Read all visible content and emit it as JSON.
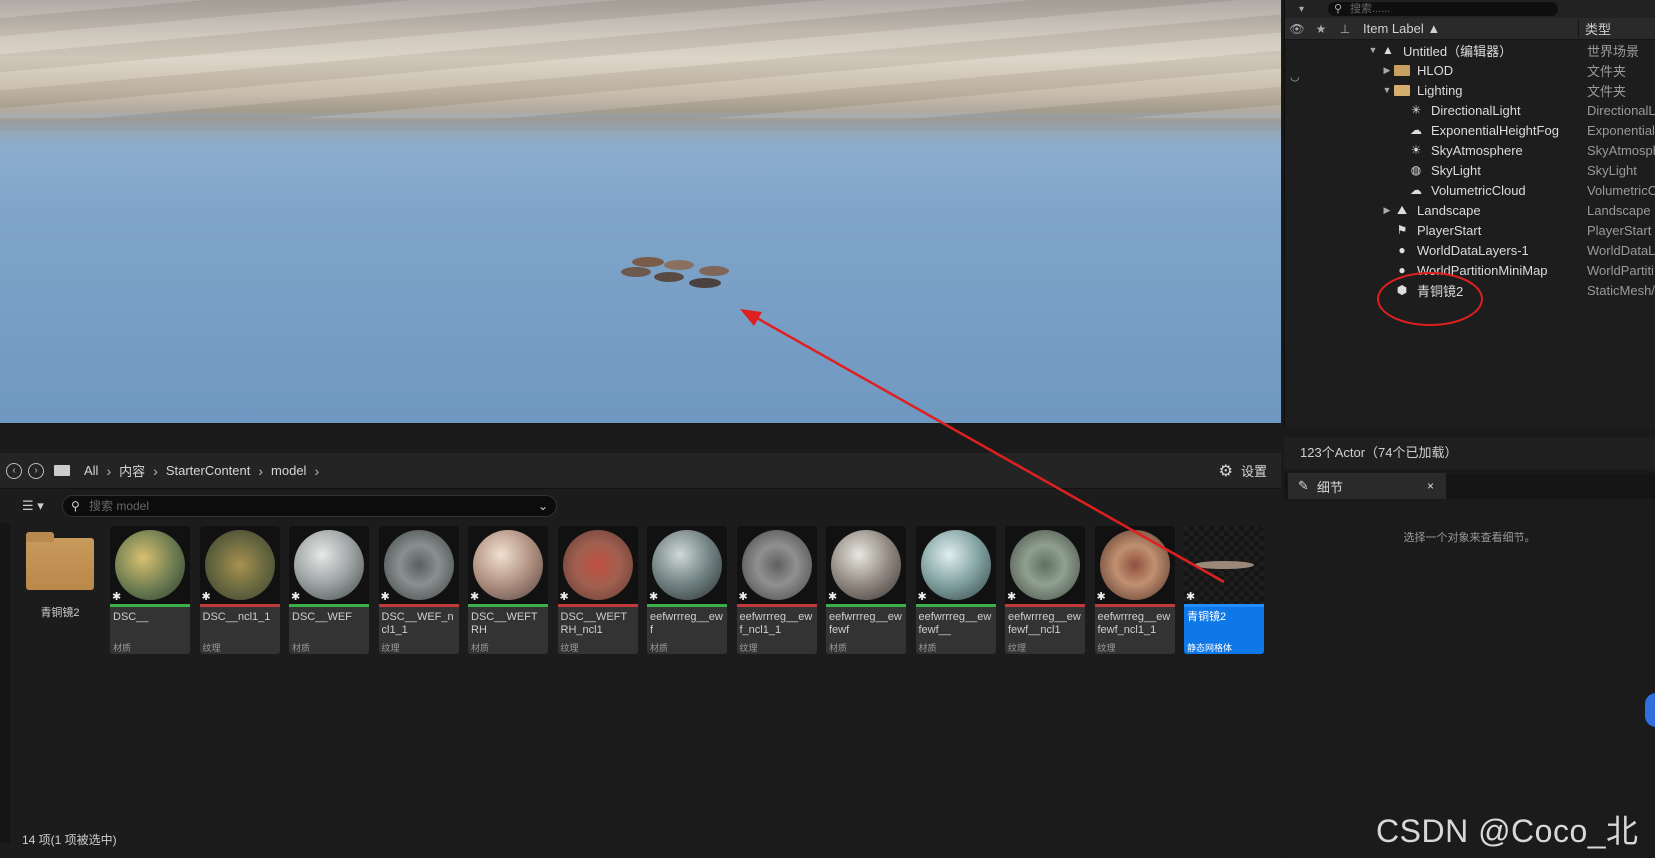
{
  "outliner": {
    "search_placeholder": "搜索......",
    "header": {
      "label": "Item Label ▲",
      "type": "类型"
    },
    "rows": [
      {
        "name": "Untitled（编辑器）",
        "type": "世界场景",
        "indent": 0,
        "arrow": "▼",
        "icon": "world-icon"
      },
      {
        "name": "HLOD",
        "type": "文件夹",
        "indent": 1,
        "arrow": "▶",
        "icon": "folder-icon"
      },
      {
        "name": "Lighting",
        "type": "文件夹",
        "indent": 1,
        "arrow": "▼",
        "icon": "folder-open-icon"
      },
      {
        "name": "DirectionalLight",
        "type": "DirectionalL",
        "indent": 2,
        "arrow": "",
        "icon": "directional-light-icon"
      },
      {
        "name": "ExponentialHeightFog",
        "type": "Exponentiall",
        "indent": 2,
        "arrow": "",
        "icon": "fog-icon"
      },
      {
        "name": "SkyAtmosphere",
        "type": "SkyAtmosph",
        "indent": 2,
        "arrow": "",
        "icon": "sky-atmosphere-icon"
      },
      {
        "name": "SkyLight",
        "type": "SkyLight",
        "indent": 2,
        "arrow": "",
        "icon": "sky-light-icon"
      },
      {
        "name": "VolumetricCloud",
        "type": "VolumetricC",
        "indent": 2,
        "arrow": "",
        "icon": "cloud-icon"
      },
      {
        "name": "Landscape",
        "type": "Landscape",
        "indent": 1,
        "arrow": "▶",
        "icon": "landscape-icon"
      },
      {
        "name": "PlayerStart",
        "type": "PlayerStart",
        "indent": 1,
        "arrow": "",
        "icon": "player-start-icon"
      },
      {
        "name": "WorldDataLayers-1",
        "type": "WorldDataL",
        "indent": 1,
        "arrow": "",
        "icon": "data-layers-icon"
      },
      {
        "name": "WorldPartitionMiniMap",
        "type": "WorldPartiti",
        "indent": 1,
        "arrow": "",
        "icon": "minimap-icon"
      },
      {
        "name": "青铜镜2",
        "type": "StaticMesh/",
        "indent": 1,
        "arrow": "",
        "icon": "static-mesh-icon"
      }
    ]
  },
  "actor_count": "123个Actor（74个已加载）",
  "details": {
    "tab_label": "细节",
    "close": "×",
    "hint": "选择一个对象来查看细节。"
  },
  "content_browser": {
    "breadcrumbs": [
      "All",
      "内容",
      "StarterContent",
      "model"
    ],
    "settings_label": "设置",
    "search_placeholder": "搜索 model",
    "folder": {
      "name": "青铜镜2"
    },
    "assets": [
      {
        "name": "DSC__",
        "type": "材质",
        "bar": "#3bb04a",
        "disc": "radial-gradient(circle at 40% 40%, #d8c070, #6a7a50 55%, #2a3a30)"
      },
      {
        "name": "DSC__ncl1_1",
        "type": "纹理",
        "bar": "#c23a3a",
        "disc": "radial-gradient(circle at 50% 50%, #a89050, #6a6a40 50%, #3a4030)"
      },
      {
        "name": "DSC__WEF",
        "type": "材质",
        "bar": "#3bb04a",
        "disc": "radial-gradient(circle at 40% 35%, #e8e8e8, #9aa0a0 50%, #404848)"
      },
      {
        "name": "DSC__WEF_ncl1_1",
        "type": "纹理",
        "bar": "#c23a3a",
        "disc": "radial-gradient(circle at 50% 50%, #5a6060, #8a9090 40%, #3a4040)"
      },
      {
        "name": "DSC__WEFTRH",
        "type": "材质",
        "bar": "#3bb04a",
        "disc": "radial-gradient(circle at 40% 35%, #f0e0d0, #b09080 50%, #504040)"
      },
      {
        "name": "DSC__WEFTRH_ncl1",
        "type": "纹理",
        "bar": "#c23a3a",
        "disc": "radial-gradient(circle at 50% 50%, #c05040, #a06050 45%, #603830)"
      },
      {
        "name": "eefwrrreg__ewf",
        "type": "材质",
        "bar": "#3bb04a",
        "disc": "radial-gradient(circle at 40% 35%, #d0d8d8, #708080 50%, #283030)"
      },
      {
        "name": "eefwrrreg__ewf_ncl1_1",
        "type": "纹理",
        "bar": "#c23a3a",
        "disc": "radial-gradient(circle at 50% 50%, #606060, #909090 40%, #404040)"
      },
      {
        "name": "eefwrrreg__ewfewf",
        "type": "材质",
        "bar": "#3bb04a",
        "disc": "radial-gradient(circle at 40% 35%, #e8e8e0, #908880 50%, #383030)"
      },
      {
        "name": "eefwrrreg__ewfewf__",
        "type": "材质",
        "bar": "#3bb04a",
        "disc": "radial-gradient(circle at 40% 35%, #e0eeee, #80a0a0 50%, #304040)"
      },
      {
        "name": "eefwrrreg__ewfewf__ncl1",
        "type": "纹理",
        "bar": "#c23a3a",
        "disc": "radial-gradient(circle at 50% 50%, #607060, #90a090 40%, #404840)"
      },
      {
        "name": "eefwrrreg__ewfewf_ncl1_1",
        "type": "纹理",
        "bar": "#c23a3a",
        "disc": "radial-gradient(circle at 50% 50%, #905040, #c09070 40%, #503028)"
      },
      {
        "name": "青铜镜2",
        "type": "静态网格体",
        "bar": "#1f8fff",
        "disc": "",
        "selected": true
      }
    ],
    "status": "14 项(1 项被选中)"
  },
  "watermark": "CSDN @Coco_北辰",
  "colors": {
    "accent": "#0f78e8",
    "annotation": "#e02020"
  }
}
